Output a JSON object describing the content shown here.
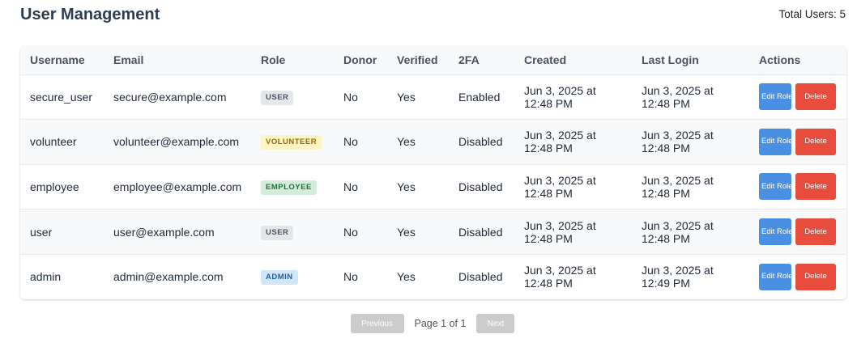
{
  "page": {
    "title": "User Management",
    "total_users_label": "Total Users: 5"
  },
  "table": {
    "headers": [
      "Username",
      "Email",
      "Role",
      "Donor",
      "Verified",
      "2FA",
      "Created",
      "Last Login",
      "Actions"
    ],
    "rows": [
      {
        "username": "secure_user",
        "email": "secure@example.com",
        "role": "USER",
        "donor": "No",
        "verified": "Yes",
        "twofa": "Enabled",
        "created": "Jun 3, 2025 at 12:48 PM",
        "last_login": "Jun 3, 2025 at 12:48 PM"
      },
      {
        "username": "volunteer",
        "email": "volunteer@example.com",
        "role": "VOLUNTEER",
        "donor": "No",
        "verified": "Yes",
        "twofa": "Disabled",
        "created": "Jun 3, 2025 at 12:48 PM",
        "last_login": "Jun 3, 2025 at 12:48 PM"
      },
      {
        "username": "employee",
        "email": "employee@example.com",
        "role": "EMPLOYEE",
        "donor": "No",
        "verified": "Yes",
        "twofa": "Disabled",
        "created": "Jun 3, 2025 at 12:48 PM",
        "last_login": "Jun 3, 2025 at 12:48 PM"
      },
      {
        "username": "user",
        "email": "user@example.com",
        "role": "USER",
        "donor": "No",
        "verified": "Yes",
        "twofa": "Disabled",
        "created": "Jun 3, 2025 at 12:48 PM",
        "last_login": "Jun 3, 2025 at 12:48 PM"
      },
      {
        "username": "admin",
        "email": "admin@example.com",
        "role": "ADMIN",
        "donor": "No",
        "verified": "Yes",
        "twofa": "Disabled",
        "created": "Jun 3, 2025 at 12:48 PM",
        "last_login": "Jun 3, 2025 at 12:49 PM"
      }
    ],
    "edit_label": "Edit Role",
    "delete_label": "Delete"
  },
  "role_colors": {
    "USER": {
      "bg": "#e4e6e9",
      "fg": "#4b5563"
    },
    "VOLUNTEER": {
      "bg": "#fdf3c4",
      "fg": "#8a6d0b"
    },
    "EMPLOYEE": {
      "bg": "#d4edda",
      "fg": "#22703a"
    },
    "ADMIN": {
      "bg": "#d2e6fa",
      "fg": "#1f5f99"
    }
  },
  "colors": {
    "edit_button": "#4a90e2",
    "delete_button": "#e74c3c",
    "pagination_disabled": "#cccccc"
  },
  "pagination": {
    "previous_label": "Previous",
    "page_info": "Page 1 of 1",
    "next_label": "Next"
  }
}
